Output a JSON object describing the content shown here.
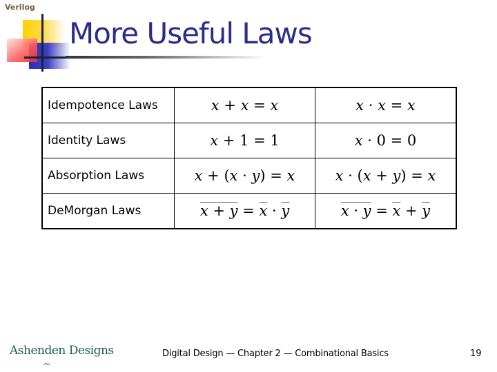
{
  "section_tag": "Verilog",
  "title": "More Useful Laws",
  "laws": [
    {
      "name": "Idempotence Laws",
      "or_form": [
        "x",
        " + ",
        "x",
        " = ",
        "x"
      ],
      "and_form": [
        "x",
        " · ",
        "x",
        " = ",
        "x"
      ]
    },
    {
      "name": "Identity Laws",
      "or_form": [
        "x",
        " + ",
        "1",
        " = ",
        "1"
      ],
      "and_form": [
        "x",
        " · ",
        "0",
        " = ",
        "0"
      ]
    },
    {
      "name": "Absorption Laws",
      "or_form": [
        "x",
        " + (",
        "x",
        " · ",
        "y",
        ") = ",
        "x"
      ],
      "and_form": [
        "x",
        " · (",
        "x",
        " + ",
        "y",
        ") = ",
        "x"
      ]
    },
    {
      "name": "DeMorgan Laws",
      "or_form": [
        "x + y",
        " = ",
        "x",
        " · ",
        "y"
      ],
      "and_form": [
        "x · y",
        " = ",
        "x",
        " + ",
        "y"
      ]
    }
  ],
  "footer": {
    "logo_text": "Ashenden Designs",
    "logo_swash": "~",
    "caption": "Digital Design — Chapter 2 — Combinational Basics",
    "page_number": "19"
  }
}
